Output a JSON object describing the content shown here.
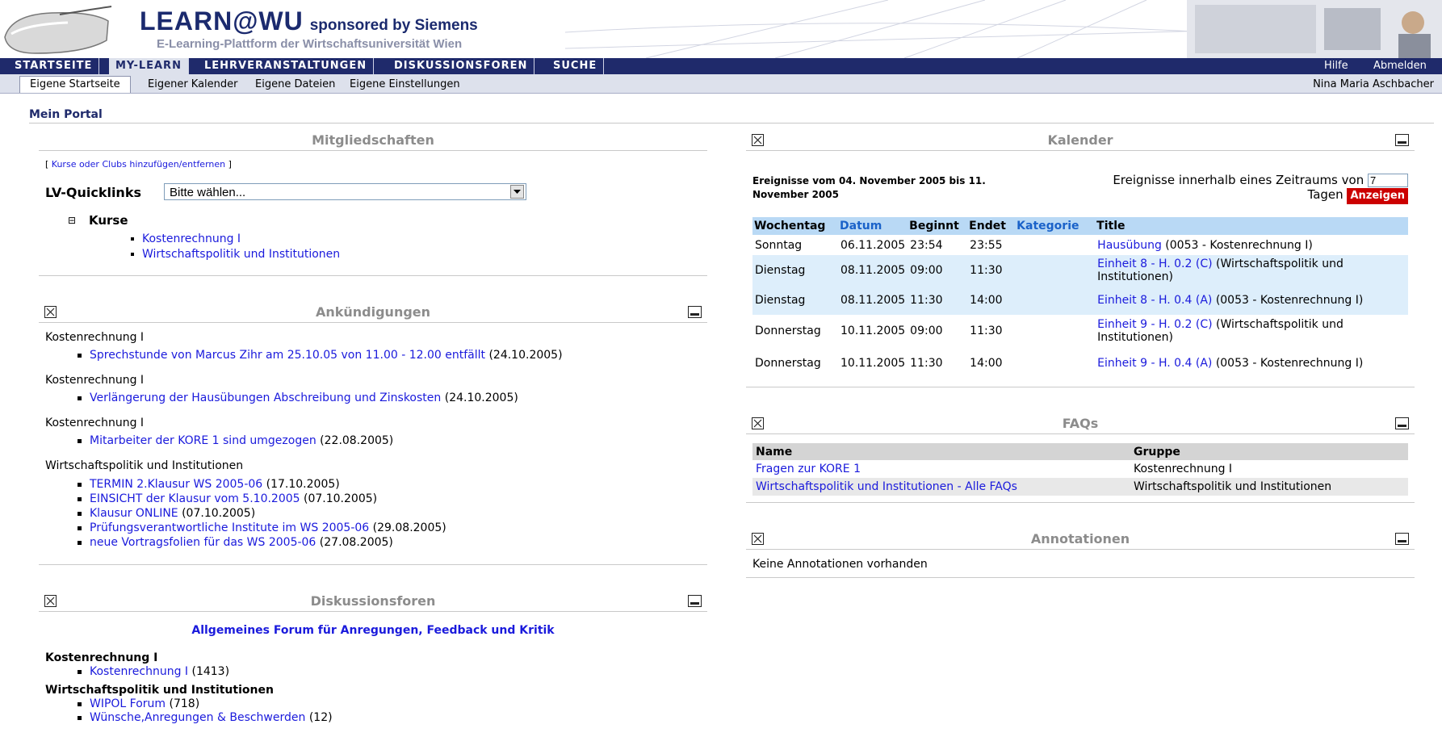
{
  "header": {
    "title": "LEARN@WU",
    "sponsor": "sponsored by Siemens",
    "subtitle": "E-Learning-Plattform der Wirtschaftsuniversität Wien"
  },
  "topnav": {
    "tabs": [
      "STARTSEITE",
      "MY-LEARN",
      "LEHRVERANSTALTUNGEN",
      "DISKUSSIONSFOREN",
      "SUCHE"
    ],
    "active": "MY-LEARN",
    "help": "Hilfe",
    "logout": "Abmelden"
  },
  "subnav": {
    "tabs": [
      "Eigene Startseite",
      "Eigener Kalender",
      "Eigene Dateien",
      "Eigene Einstellungen"
    ],
    "user": "Nina Maria Aschbacher"
  },
  "portal_title": "Mein Portal",
  "memberships": {
    "title": "Mitgliedschaften",
    "bracket_open": "[",
    "manage_link": "Kurse oder Clubs hinzufügen/entfernen",
    "bracket_close": "]",
    "quicklinks_label": "LV-Quicklinks",
    "quicklinks_value": "Bitte wählen...",
    "tree_toggle": "⊟",
    "tree_label": "Kurse",
    "courses": [
      "Kostenrechnung I",
      "Wirtschaftspolitik und Institutionen"
    ]
  },
  "announcements": {
    "title": "Ankündigungen",
    "groups": [
      {
        "course": "Kostenrechnung I",
        "items": [
          {
            "text": "Sprechstunde von Marcus Zihr am 25.10.05 von 11.00 - 12.00 entfällt",
            "date": "(24.10.2005)"
          }
        ]
      },
      {
        "course": "Kostenrechnung I",
        "items": [
          {
            "text": "Verlängerung der Hausübungen Abschreibung und Zinskosten",
            "date": "(24.10.2005)"
          }
        ]
      },
      {
        "course": "Kostenrechnung I",
        "items": [
          {
            "text": "Mitarbeiter der KORE 1 sind umgezogen",
            "date": "(22.08.2005)"
          }
        ]
      },
      {
        "course": "Wirtschaftspolitik und Institutionen",
        "items": [
          {
            "text": "TERMIN 2.Klausur WS 2005-06",
            "date": "(17.10.2005)"
          },
          {
            "text": "EINSICHT der Klausur vom 5.10.2005",
            "date": "(07.10.2005)"
          },
          {
            "text": "Klausur ONLINE",
            "date": "(07.10.2005)"
          },
          {
            "text": "Prüfungsverantwortliche Institute im WS 2005-06",
            "date": "(29.08.2005)"
          },
          {
            "text": "neue Vortragsfolien für das WS 2005-06",
            "date": "(27.08.2005)"
          }
        ]
      }
    ]
  },
  "forums": {
    "title": "Diskussionsforen",
    "general_link": "Allgemeines Forum für Anregungen, Feedback und Kritik",
    "groups": [
      {
        "course": "Kostenrechnung I",
        "items": [
          {
            "text": "Kostenrechnung I",
            "count": "(1413)"
          }
        ]
      },
      {
        "course": "Wirtschaftspolitik und Institutionen",
        "items": [
          {
            "text": "WIPOL Forum",
            "count": "(718)"
          },
          {
            "text": "Wünsche,Anregungen & Beschwerden",
            "count": "(12)"
          }
        ]
      }
    ]
  },
  "calendar": {
    "title": "Kalender",
    "events_range": "Ereignisse vom 04. November 2005 bis 11. November 2005",
    "range_label": "Ereignisse innerhalb eines Zeitraums von",
    "range_value": "7",
    "days_label": "Tagen",
    "show_button": "Anzeigen",
    "columns": [
      "Wochentag",
      "Datum",
      "Beginnt",
      "Endet",
      "Kategorie",
      "Title"
    ],
    "rows": [
      {
        "day": "Sonntag",
        "date": "06.11.2005",
        "start": "23:54",
        "end": "23:55",
        "category": "",
        "title_link": "Hausübung",
        "title_rest": "(0053 - Kostenrechnung I)"
      },
      {
        "day": "Dienstag",
        "date": "08.11.2005",
        "start": "09:00",
        "end": "11:30",
        "category": "",
        "title_link": "Einheit 8 - H. 0.2 (C)",
        "title_rest": "(Wirtschaftspolitik und Institutionen)"
      },
      {
        "day": "Dienstag",
        "date": "08.11.2005",
        "start": "11:30",
        "end": "14:00",
        "category": "",
        "title_link": "Einheit 8 - H. 0.4 (A)",
        "title_rest": "(0053 - Kostenrechnung I)"
      },
      {
        "day": "Donnerstag",
        "date": "10.11.2005",
        "start": "09:00",
        "end": "11:30",
        "category": "",
        "title_link": "Einheit 9 - H. 0.2 (C)",
        "title_rest": "(Wirtschaftspolitik und Institutionen)"
      },
      {
        "day": "Donnerstag",
        "date": "10.11.2005",
        "start": "11:30",
        "end": "14:00",
        "category": "",
        "title_link": "Einheit 9 - H. 0.4 (A)",
        "title_rest": "(0053 - Kostenrechnung I)"
      }
    ]
  },
  "faqs": {
    "title": "FAQs",
    "columns": [
      "Name",
      "Gruppe"
    ],
    "rows": [
      {
        "name": "Fragen zur KORE 1",
        "group": "Kostenrechnung I"
      },
      {
        "name": "Wirtschaftspolitik und Institutionen - Alle FAQs",
        "group": "Wirtschaftspolitik und Institutionen"
      }
    ]
  },
  "annotations": {
    "title": "Annotationen",
    "empty": "Keine Annotationen vorhanden"
  },
  "colors": {
    "nav_bg": "#1f2a6b",
    "subnav_bg": "#dde1ec",
    "link": "#1a1adc",
    "calendar_header": "#b9d9f5",
    "button_red": "#cc0000"
  }
}
